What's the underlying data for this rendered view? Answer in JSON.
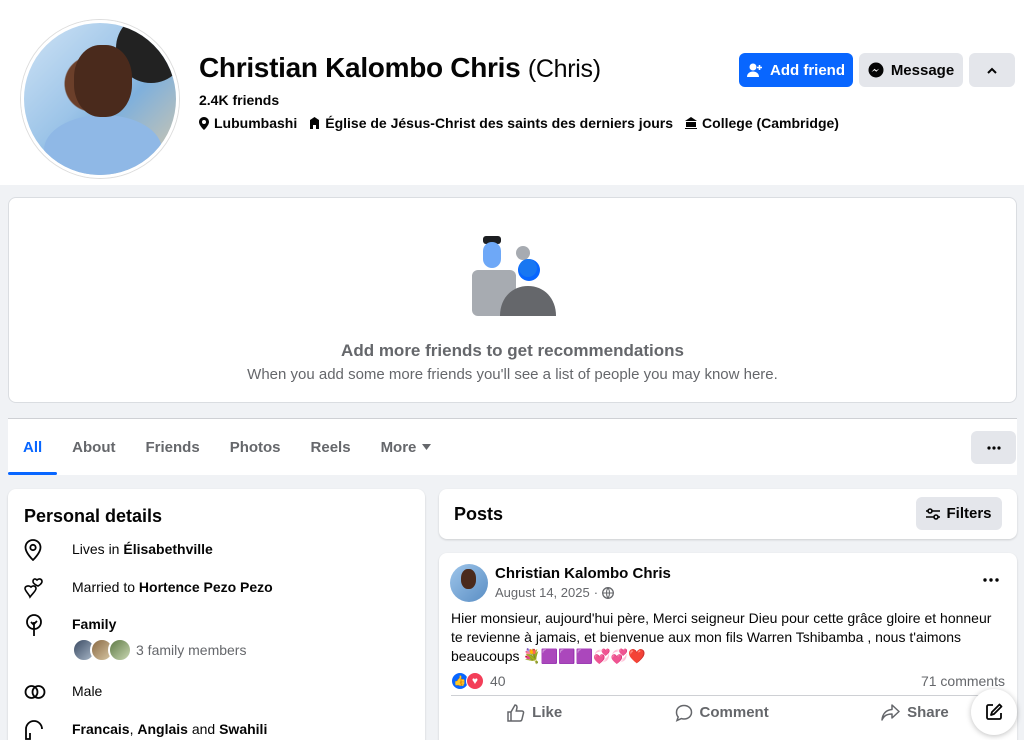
{
  "profile": {
    "name": "Christian Kalombo Chris",
    "nickname": "(Chris)",
    "friends_count": "2.4K friends",
    "location": "Lubumbashi",
    "church": "Église de Jésus-Christ des saints des derniers jours",
    "education": "College (Cambridge)"
  },
  "actions": {
    "add_friend": "Add friend",
    "message": "Message"
  },
  "recommendations": {
    "title": "Add more friends to get recommendations",
    "subtitle": "When you add some more friends you'll see a list of people you may know here."
  },
  "tabs": [
    {
      "label": "All",
      "active": true
    },
    {
      "label": "About"
    },
    {
      "label": "Friends"
    },
    {
      "label": "Photos"
    },
    {
      "label": "Reels"
    },
    {
      "label": "More"
    }
  ],
  "personal_details": {
    "title": "Personal details",
    "lives_prefix": "Lives in ",
    "lives_in": "Élisabethville",
    "married_prefix": "Married to ",
    "spouse": "Hortence Pezo Pezo",
    "family_label": "Family",
    "family_count": "3 family members",
    "gender": "Male",
    "languages_1": "Francais",
    "languages_sep1": ", ",
    "languages_2": "Anglais",
    "languages_sep2": " and ",
    "languages_3": "Swahili"
  },
  "posts": {
    "title": "Posts",
    "filters": "Filters"
  },
  "post": {
    "author": "Christian Kalombo Chris",
    "date": "August 14, 2025",
    "date_sep": "·",
    "text": "Hier monsieur, aujourd'hui père, Merci seigneur Dieu pour cette grâce gloire et honneur te revienne à jamais, et bienvenue aux mon fils Warren Tshibamba , nous t'aimons beaucoups",
    "emojis": "💐🟪🟪🟪💞💞❤️",
    "reactions": "40",
    "comments": "71 comments",
    "like": "Like",
    "comment": "Comment",
    "share": "Share"
  },
  "colors": {
    "brand_blue": "#0866ff",
    "background": "#f0f2f5",
    "secondary_text": "#65676b"
  }
}
